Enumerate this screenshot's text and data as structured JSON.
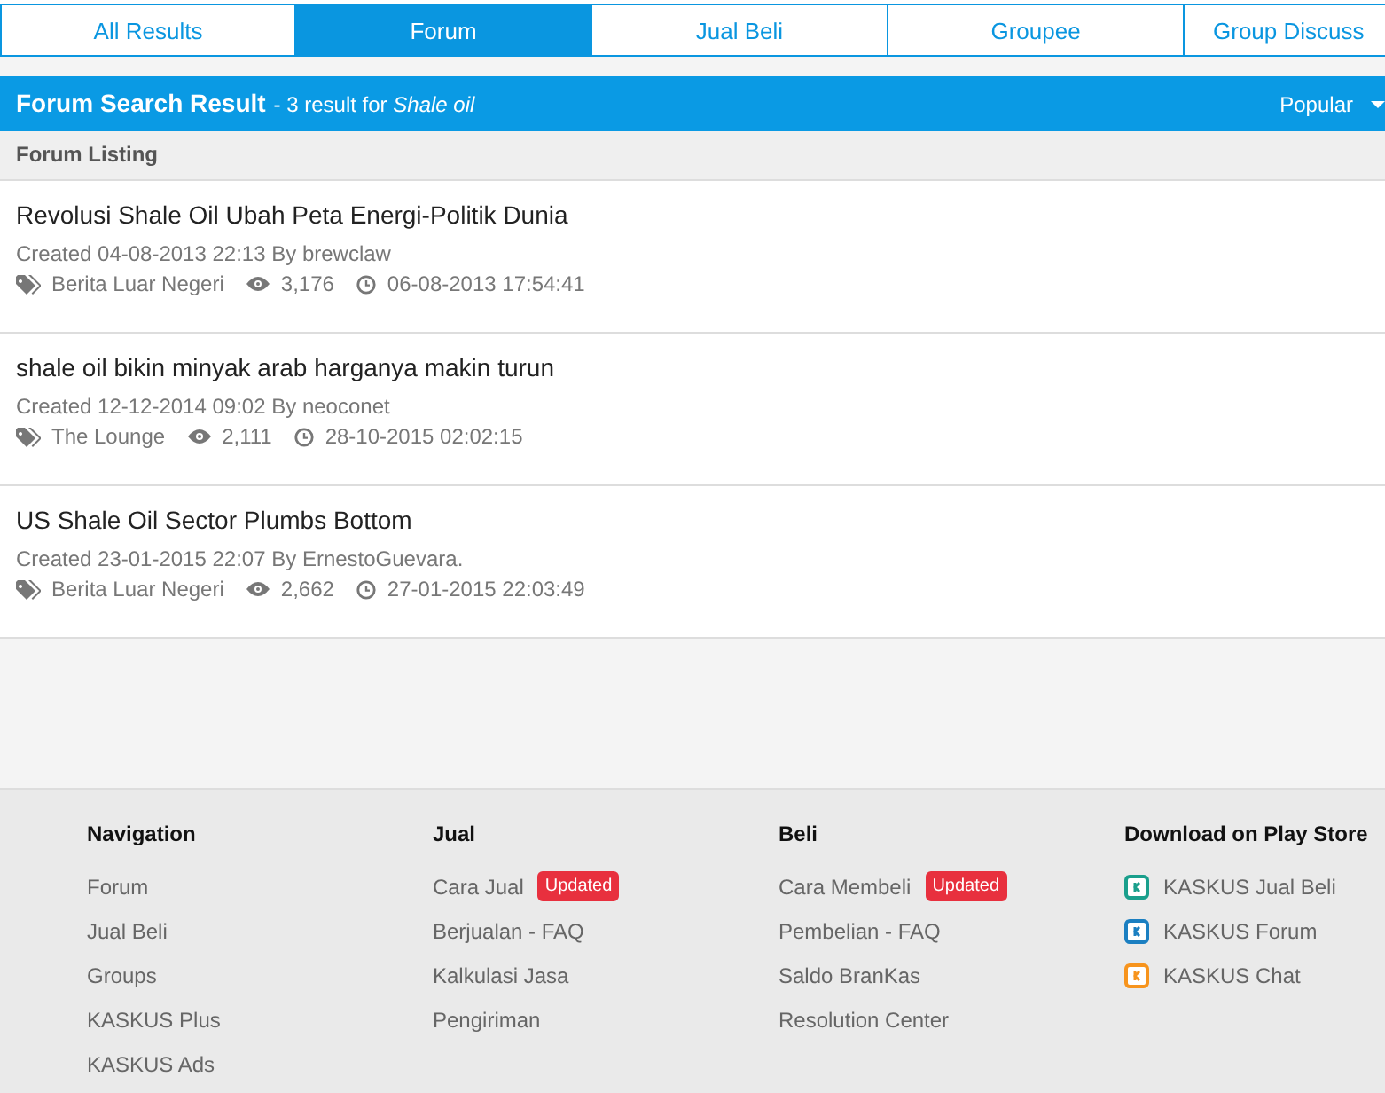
{
  "tabs": [
    {
      "label": "All Results",
      "selected": false
    },
    {
      "label": "Forum",
      "selected": true
    },
    {
      "label": "Jual Beli",
      "selected": false
    },
    {
      "label": "Groupee",
      "selected": false
    },
    {
      "label": "Group Discuss",
      "selected": false
    }
  ],
  "result_header": {
    "title": "Forum Search Result",
    "summary": " - 3 result for *Shale oil*",
    "sort": "Popular"
  },
  "listing_header": "Forum Listing",
  "threads": [
    {
      "title": "Revolusi Shale Oil Ubah Peta Energi-Politik Dunia",
      "created": "Created 04-08-2013 22:13 By brewclaw",
      "category": "Berita Luar Negeri",
      "views": "3,176",
      "last_post": "06-08-2013 17:54:41"
    },
    {
      "title": "shale oil bikin minyak arab harganya makin turun",
      "created": "Created 12-12-2014 09:02 By neoconet",
      "category": "The Lounge",
      "views": "2,111",
      "last_post": "28-10-2015 02:02:15"
    },
    {
      "title": "US Shale Oil Sector Plumbs Bottom",
      "created": "Created 23-01-2015 22:07 By ErnestoGuevara.",
      "category": "Berita Luar Negeri",
      "views": "2,662",
      "last_post": "27-01-2015 22:03:49"
    }
  ],
  "footer": [
    {
      "heading": "Navigation",
      "links": [
        {
          "label": "Forum"
        },
        {
          "label": "Jual Beli"
        },
        {
          "label": "Groups"
        },
        {
          "label": "KASKUS Plus"
        },
        {
          "label": "KASKUS Ads"
        }
      ]
    },
    {
      "heading": "Jual",
      "links": [
        {
          "label": "Cara Jual",
          "badge": "Updated"
        },
        {
          "label": "Berjualan - FAQ"
        },
        {
          "label": "Kalkulasi Jasa"
        },
        {
          "label": "Pengiriman"
        }
      ]
    },
    {
      "heading": "Beli",
      "links": [
        {
          "label": "Cara Membeli",
          "badge": "Updated"
        },
        {
          "label": "Pembelian - FAQ"
        },
        {
          "label": "Saldo BranKas"
        },
        {
          "label": "Resolution Center"
        }
      ]
    },
    {
      "heading": "Download on Play Store",
      "links": [
        {
          "label": "KASKUS Jual Beli",
          "color": "#1a9f8c"
        },
        {
          "label": "KASKUS Forum",
          "color": "#1b7fc1"
        },
        {
          "label": "KASKUS Chat",
          "color": "#f7941d"
        }
      ]
    }
  ]
}
